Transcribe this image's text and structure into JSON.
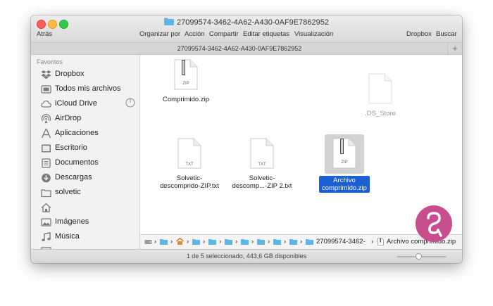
{
  "window": {
    "title": "27099574-3462-4A62-A430-0AF9E7862952",
    "toolbar": {
      "back": "Atrás",
      "arrange": "Organizar por",
      "action": "Acción",
      "share": "Compartir",
      "tags": "Editar etiquetas",
      "view": "Visualización",
      "dropbox": "Dropbox",
      "search": "Buscar"
    },
    "path_title": "27099574-3462-4A62-A430-0AF9E7862952",
    "new_tab": "+"
  },
  "sidebar": {
    "header": "Favoritos",
    "items": [
      {
        "label": "Dropbox",
        "icon": "dropbox-icon"
      },
      {
        "label": "Todos mis archivos",
        "icon": "all-files-icon"
      },
      {
        "label": "iCloud Drive",
        "icon": "cloud-icon"
      },
      {
        "label": "AirDrop",
        "icon": "airdrop-icon"
      },
      {
        "label": "Aplicaciones",
        "icon": "applications-icon"
      },
      {
        "label": "Escritorio",
        "icon": "desktop-icon"
      },
      {
        "label": "Documentos",
        "icon": "documents-icon"
      },
      {
        "label": "Descargas",
        "icon": "downloads-icon"
      },
      {
        "label": "solvetic",
        "icon": "folder-icon"
      },
      {
        "label": "",
        "icon": "home-icon"
      },
      {
        "label": "Imágenes",
        "icon": "pictures-icon"
      },
      {
        "label": "Música",
        "icon": "music-icon"
      }
    ]
  },
  "files": [
    {
      "name": "Comprimido.zip",
      "type": "ZIP",
      "selected": false
    },
    {
      "name": ".DS_Store",
      "type": "",
      "selected": false
    },
    {
      "name": "Solvetic-descomprido-ZIP.txt",
      "type": "TXT",
      "selected": false
    },
    {
      "name": "Solvetic-descomp...-ZIP 2.txt",
      "type": "TXT",
      "selected": false
    },
    {
      "name": "Archivo comprimido.zip",
      "type": "ZIP",
      "selected": true
    }
  ],
  "file_labels": {
    "f0": [
      "Comprimido.zip"
    ],
    "f1": [
      ".DS_Store"
    ],
    "f2": [
      "Solvetic-",
      "descomprido-ZIP.txt"
    ],
    "f3": [
      "Solvetic-",
      "descomp...-ZIP 2.txt"
    ],
    "f4": [
      "Archivo",
      "comprimido.zip"
    ]
  },
  "pathbar": {
    "separator": "›",
    "folder_segment": "27099574-3462-",
    "file_segment": "Archivo comprimido.zip"
  },
  "status": {
    "text": "1 de 5 seleccionado, 443,6 GB disponibles"
  },
  "colors": {
    "selection": "#1a5fd4",
    "folder": "#5fb4e8",
    "close": "#fc5d57",
    "minimize": "#fdbc40",
    "maximize": "#34c84a"
  }
}
